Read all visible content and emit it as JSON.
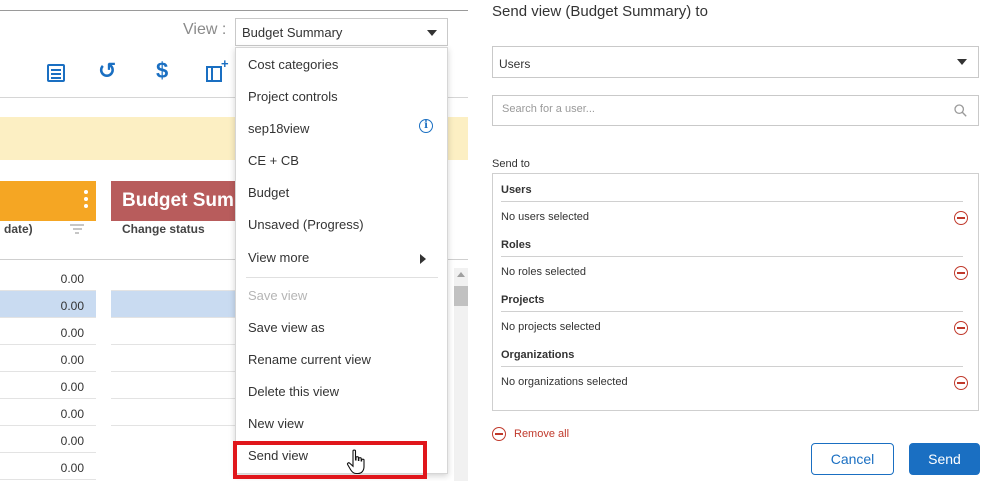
{
  "view_selector": {
    "label": "View :",
    "selected": "Budget Summary"
  },
  "toolbar": {
    "icons": [
      "list-icon",
      "undo-icon",
      "dollar-icon",
      "add-column-icon"
    ],
    "accent_color": "#1a6fc2"
  },
  "grid": {
    "header_left_color": "#f5a623",
    "header_right_title": "Budget Summ",
    "header_right_color": "#b85c5c",
    "columns": [
      "date)",
      "Change status"
    ],
    "rows": [
      "0.00",
      "0.00",
      "0.00",
      "0.00",
      "0.00",
      "0.00",
      "0.00",
      "0.00"
    ],
    "highlighted_row_index": 1
  },
  "view_menu": {
    "items": [
      {
        "label": "Cost categories"
      },
      {
        "label": "Project controls"
      },
      {
        "label": "sep18view",
        "icon": "info-icon"
      },
      {
        "label": "CE + CB"
      },
      {
        "label": "Budget"
      },
      {
        "label": "Unsaved (Progress)"
      },
      {
        "label": "View more",
        "icon": "chevron-right-icon"
      }
    ],
    "actions": [
      {
        "label": "Save view",
        "disabled": true
      },
      {
        "label": "Save view as"
      },
      {
        "label": "Rename current view"
      },
      {
        "label": "Delete this view"
      },
      {
        "label": "New view"
      },
      {
        "label": "Send view",
        "highlighted": true
      }
    ],
    "highlight_color": "#e0161b"
  },
  "send_dialog": {
    "title": "Send view (Budget Summary) to",
    "recipient_type": "Users",
    "search_placeholder": "Search for a user...",
    "send_to_label": "Send to",
    "groups": [
      {
        "title": "Users",
        "empty_text": "No users selected"
      },
      {
        "title": "Roles",
        "empty_text": "No roles selected"
      },
      {
        "title": "Projects",
        "empty_text": "No projects selected"
      },
      {
        "title": "Organizations",
        "empty_text": "No organizations selected"
      }
    ],
    "remove_all_label": "Remove all",
    "cancel_label": "Cancel",
    "send_label": "Send",
    "remove_color": "#c0392b"
  }
}
